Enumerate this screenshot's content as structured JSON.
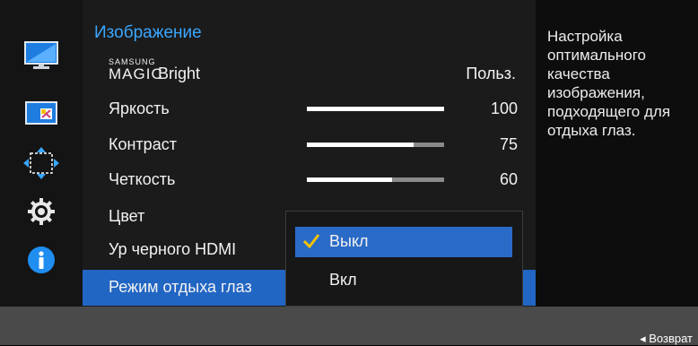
{
  "menu": {
    "title": "Изображение",
    "magic_bright": {
      "brand_top": "SAMSUNG",
      "brand_bottom": "MAGIC",
      "name": "Bright",
      "value": "Польз."
    },
    "brightness": {
      "label": "Яркость",
      "value": "100",
      "fraction": 1.0
    },
    "contrast": {
      "label": "Контраст",
      "value": "75",
      "fraction": 0.78
    },
    "sharpness": {
      "label": "Четкость",
      "value": "60",
      "fraction": 0.62
    },
    "color": {
      "label": "Цвет"
    },
    "hdmi_black": {
      "label": "Ур черного HDMI"
    },
    "eye_saver": {
      "label": "Режим отдыха глаз"
    }
  },
  "popup": {
    "options": [
      {
        "label": "Выкл",
        "selected": true
      },
      {
        "label": "Вкл",
        "selected": false
      }
    ]
  },
  "description": "Настройка оптимального качества изображения, подходящего для отдыха глаз.",
  "footer": {
    "back_label": "◂ Возврат"
  },
  "sidebar": {
    "icons": [
      "picture-icon",
      "pip-icon",
      "display-position-icon",
      "settings-icon",
      "info-icon"
    ]
  },
  "colors": {
    "accent": "#3aa6ff",
    "selected": "#2266c4"
  }
}
